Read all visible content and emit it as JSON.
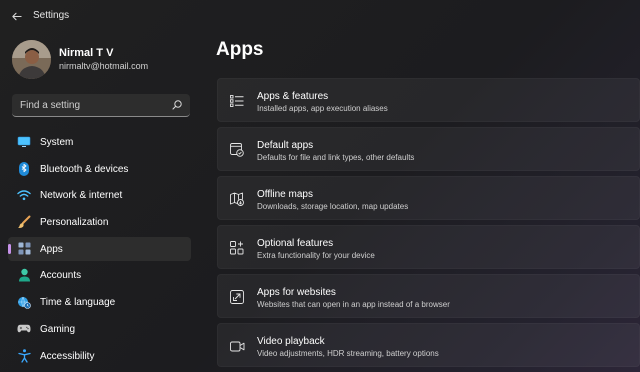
{
  "window": {
    "title": "Settings"
  },
  "profile": {
    "name": "Nirmal T V",
    "email": "nirmaltv@hotmail.com"
  },
  "search": {
    "placeholder": "Find a setting"
  },
  "nav": {
    "items": [
      {
        "label": "System",
        "icon": "monitor-icon",
        "selected": false
      },
      {
        "label": "Bluetooth & devices",
        "icon": "bluetooth-icon",
        "selected": false
      },
      {
        "label": "Network & internet",
        "icon": "wifi-icon",
        "selected": false
      },
      {
        "label": "Personalization",
        "icon": "brush-icon",
        "selected": false
      },
      {
        "label": "Apps",
        "icon": "apps-icon",
        "selected": true
      },
      {
        "label": "Accounts",
        "icon": "person-icon",
        "selected": false
      },
      {
        "label": "Time & language",
        "icon": "globe-clock-icon",
        "selected": false
      },
      {
        "label": "Gaming",
        "icon": "gamepad-icon",
        "selected": false
      },
      {
        "label": "Accessibility",
        "icon": "accessibility-icon",
        "selected": false
      }
    ]
  },
  "main": {
    "title": "Apps",
    "cards": [
      {
        "title": "Apps & features",
        "subtitle": "Installed apps, app execution aliases",
        "icon": "list-icon"
      },
      {
        "title": "Default apps",
        "subtitle": "Defaults for file and link types, other defaults",
        "icon": "default-apps-icon"
      },
      {
        "title": "Offline maps",
        "subtitle": "Downloads, storage location, map updates",
        "icon": "map-icon"
      },
      {
        "title": "Optional features",
        "subtitle": "Extra functionality for your device",
        "icon": "optional-features-icon"
      },
      {
        "title": "Apps for websites",
        "subtitle": "Websites that can open in an app instead of a browser",
        "icon": "open-link-icon"
      },
      {
        "title": "Video playback",
        "subtitle": "Video adjustments, HDR streaming, battery options",
        "icon": "video-icon"
      }
    ]
  },
  "colors": {
    "accent": "#c792ea",
    "background": "#202020",
    "card": "#2b2b2b"
  }
}
